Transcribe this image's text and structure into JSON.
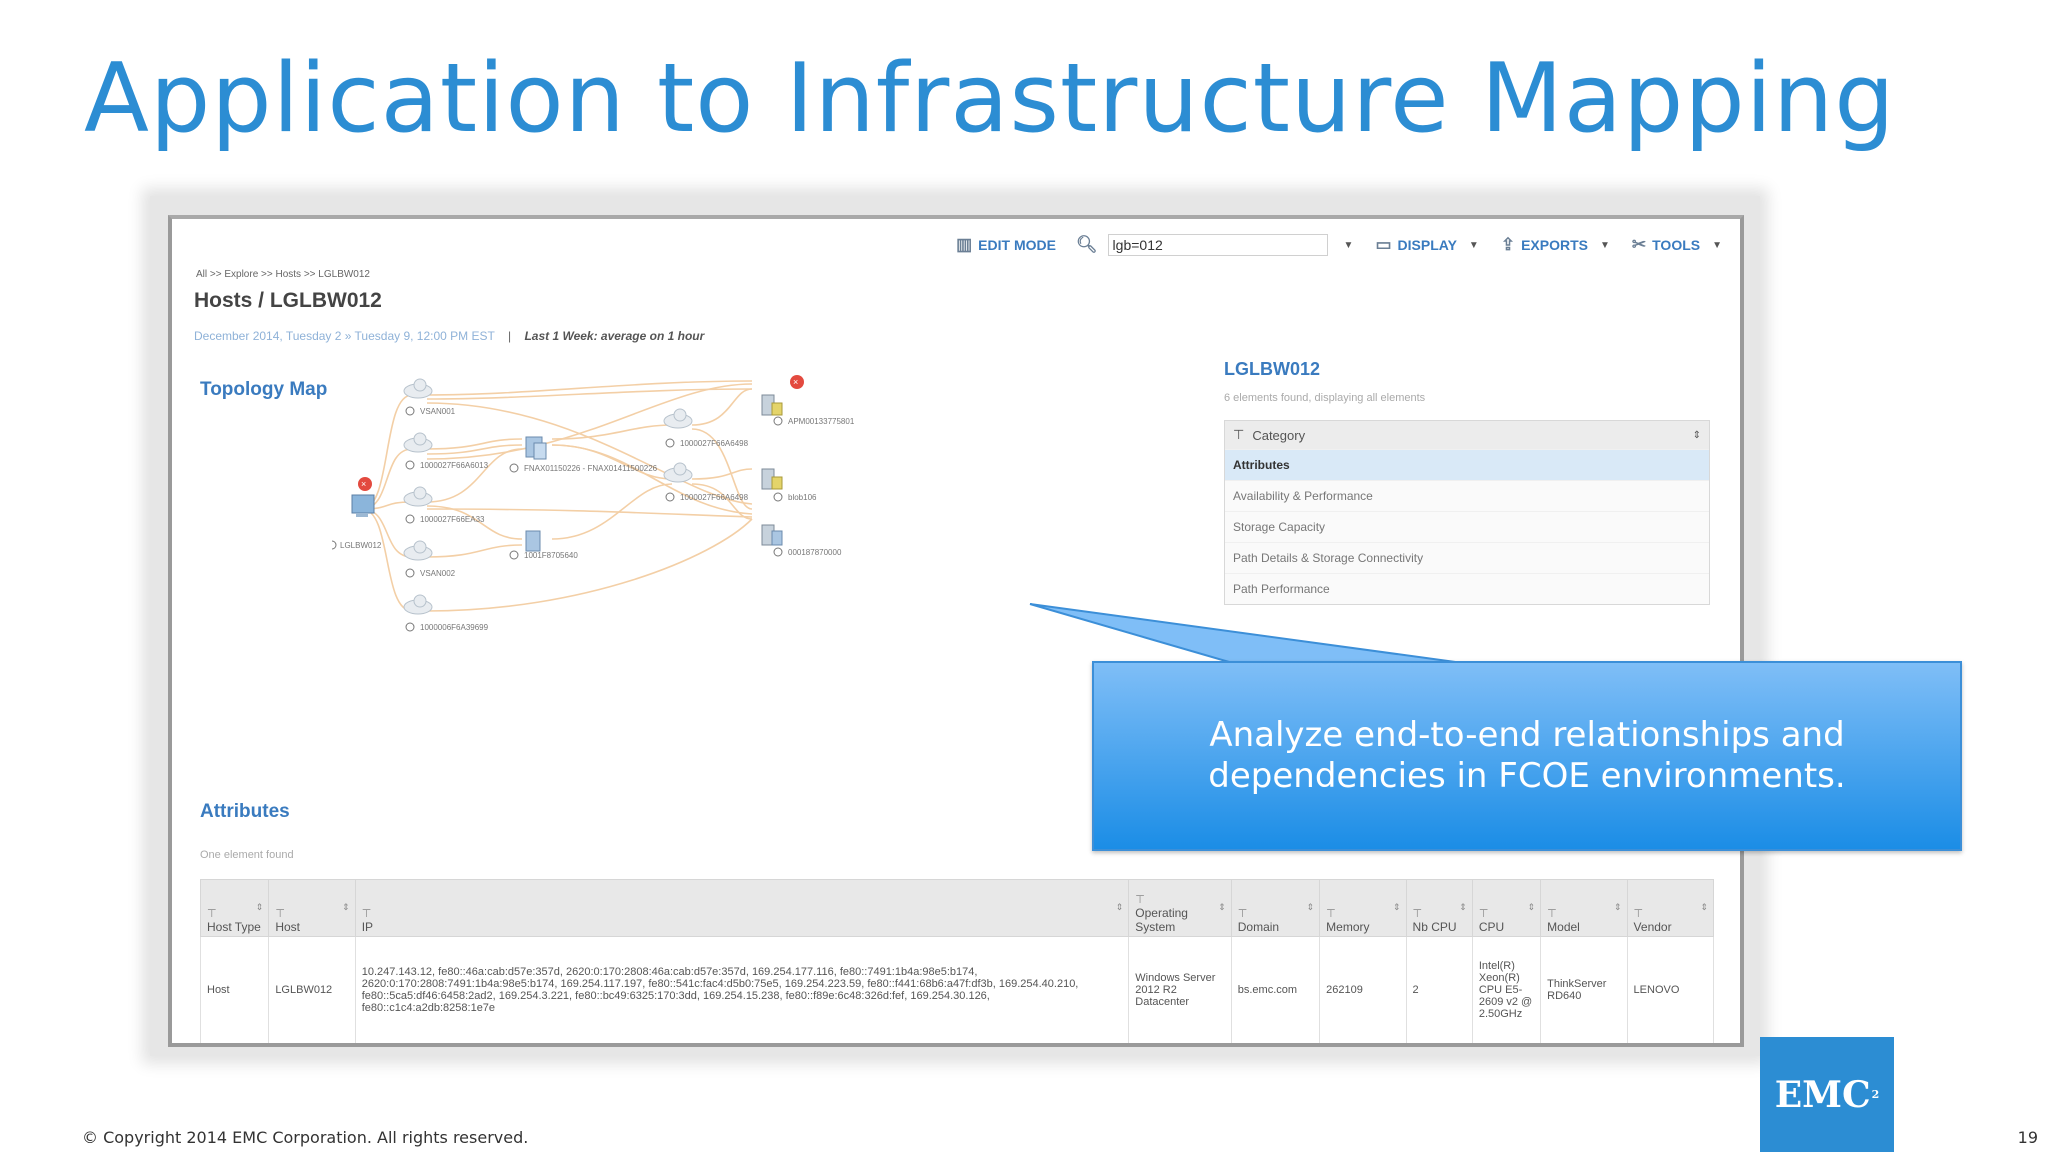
{
  "slide": {
    "title": "Application to Infrastructure Mapping",
    "copyright": "© Copyright 2014 EMC Corporation. All rights reserved.",
    "page_number": "19",
    "logo_text": "EMC",
    "logo_superscript": "2"
  },
  "toolbar": {
    "edit_mode_label": "EDIT MODE",
    "search_value": "lgb=012",
    "display_label": "DISPLAY",
    "exports_label": "EXPORTS",
    "tools_label": "TOOLS"
  },
  "breadcrumb": "All >> Explore >> Hosts >> LGLBW012",
  "page_heading": "Hosts / LGLBW012",
  "date_range": {
    "dates": "December 2014, Tuesday 2 » Tuesday 9, 12:00 PM EST",
    "separator": "|",
    "period": "Last 1 Week: average on 1 hour"
  },
  "topology": {
    "title": "Topology Map",
    "nodes": [
      {
        "id": "host",
        "label": "LGLBW012",
        "kind": "host",
        "error": true
      },
      {
        "id": "c1",
        "label": "VSAN001",
        "kind": "cloud"
      },
      {
        "id": "c2",
        "label": "1000027F66A6013",
        "kind": "cloud"
      },
      {
        "id": "c3",
        "label": "1000027F66EA33",
        "kind": "cloud"
      },
      {
        "id": "c4",
        "label": "VSAN002",
        "kind": "cloud"
      },
      {
        "id": "c5",
        "label": "1000006F6A39699",
        "kind": "cloud"
      },
      {
        "id": "sw1",
        "label": "FNAX01150226 - FNAX01411500226",
        "kind": "switch"
      },
      {
        "id": "sw2",
        "label": "1001F8705640",
        "kind": "switch"
      },
      {
        "id": "c6",
        "label": "1000027F66A6498",
        "kind": "cloud"
      },
      {
        "id": "c7",
        "label": "1000027F66A6498",
        "kind": "cloud"
      },
      {
        "id": "a1",
        "label": "APM00133775801",
        "kind": "array",
        "error": true
      },
      {
        "id": "a2",
        "label": "blob106",
        "kind": "array"
      },
      {
        "id": "a3",
        "label": "000187870000",
        "kind": "array"
      }
    ]
  },
  "details_panel": {
    "title": "LGLBW012",
    "count_text": "6 elements found, displaying all elements",
    "column_header": "Category",
    "categories": [
      "Attributes",
      "Availability & Performance",
      "Storage Capacity",
      "Path Details & Storage Connectivity",
      "Path Performance"
    ],
    "selected_index": 0
  },
  "callout": {
    "text": "Analyze end-to-end relationships and dependencies in FCOE environments."
  },
  "attributes": {
    "title": "Attributes",
    "count_text": "One element found",
    "columns": [
      "Host Type",
      "Host",
      "IP",
      "Operating System",
      "Domain",
      "Memory",
      "Nb CPU",
      "CPU",
      "Model",
      "Vendor"
    ],
    "rows": [
      [
        "Host",
        "LGLBW012",
        "10.247.143.12, fe80::46a:cab:d57e:357d, 2620:0:170:2808:46a:cab:d57e:357d, 169.254.177.116, fe80::7491:1b4a:98e5:b174, 2620:0:170:2808:7491:1b4a:98e5:b174, 169.254.117.197, fe80::541c:fac4:d5b0:75e5, 169.254.223.59, fe80::f441:68b6:a47f:df3b, 169.254.40.210, fe80::5ca5:df46:6458:2ad2, 169.254.3.221, fe80::bc49:6325:170:3dd, 169.254.15.238, fe80::f89e:6c48:326d:fef, 169.254.30.126, fe80::c1c4:a2db:8258:1e7e",
        "Windows Server 2012 R2 Datacenter",
        "bs.emc.com",
        "262109",
        "2",
        "Intel(R) Xeon(R) CPU E5-2609 v2 @ 2.50GHz",
        "ThinkServer RD640",
        "LENOVO"
      ]
    ]
  }
}
